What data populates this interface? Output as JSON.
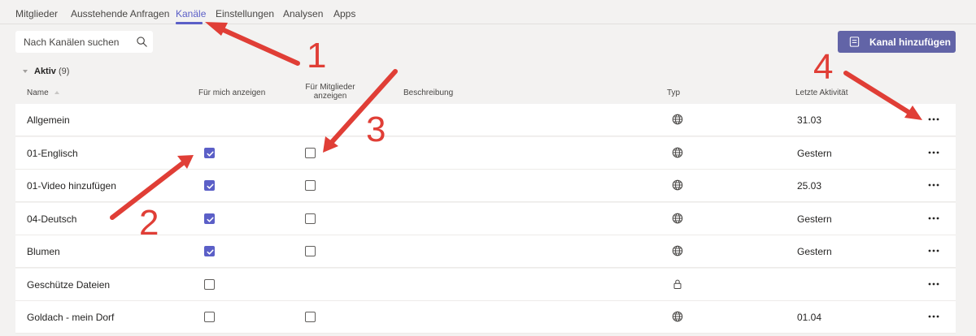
{
  "tabs": [
    {
      "label": "Mitglieder"
    },
    {
      "label": "Ausstehende Anfragen"
    },
    {
      "label": "Kanäle"
    },
    {
      "label": "Einstellungen"
    },
    {
      "label": "Analysen"
    },
    {
      "label": "Apps"
    }
  ],
  "active_tab": "Kanäle",
  "search": {
    "placeholder": "Nach Kanälen suchen",
    "value": ""
  },
  "add_button": {
    "label": "Kanal hinzufügen"
  },
  "section": {
    "title": "Aktiv",
    "count": "(9)"
  },
  "columns": {
    "name": "Name",
    "show_me": "Für mich anzeigen",
    "show_members_1": "Für Mitglieder",
    "show_members_2": "anzeigen",
    "description": "Beschreibung",
    "type": "Typ",
    "last_activity": "Letzte Aktivität"
  },
  "rows": [
    {
      "name": "Allgemein",
      "show_me": null,
      "show_members": null,
      "type_icon": "globe-icon",
      "last_activity": "31.03"
    },
    {
      "name": "01-Englisch",
      "show_me": true,
      "show_members": false,
      "type_icon": "globe-icon",
      "last_activity": "Gestern"
    },
    {
      "name": "01-Video hinzufügen",
      "show_me": true,
      "show_members": false,
      "type_icon": "globe-icon",
      "last_activity": "25.03"
    },
    {
      "name": "04-Deutsch",
      "show_me": true,
      "show_members": false,
      "type_icon": "globe-icon",
      "last_activity": "Gestern"
    },
    {
      "name": "Blumen",
      "show_me": true,
      "show_members": false,
      "type_icon": "globe-icon",
      "last_activity": "Gestern"
    },
    {
      "name": "Geschütze Dateien",
      "show_me": false,
      "show_members": null,
      "type_icon": "lock-icon",
      "last_activity": ""
    },
    {
      "name": "Goldach - mein Dorf",
      "show_me": false,
      "show_members": false,
      "type_icon": "globe-icon",
      "last_activity": "01.04"
    }
  ],
  "annotations": [
    "1",
    "2",
    "3",
    "4"
  ],
  "colors": {
    "accent": "#5b5fc7",
    "button": "#6264a7",
    "annotation": "#e03e36",
    "background": "#f3f2f1"
  }
}
